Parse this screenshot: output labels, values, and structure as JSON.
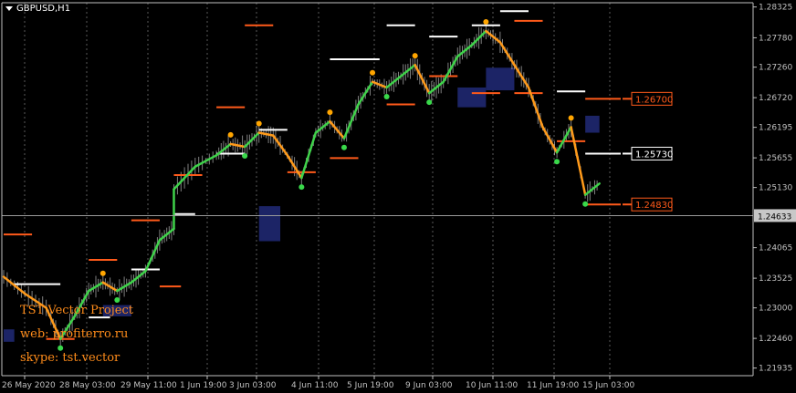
{
  "symbol_title": "GBPUSD,H1",
  "watermark": {
    "line1": "TST Vector Project",
    "line2": "web: profiterro.ru",
    "line3": "skype: tst.vector"
  },
  "colors": {
    "background": "#000000",
    "axis": "#c0c0c0",
    "candle": "#e8e8e8",
    "bull_line": "#3fd24a",
    "bear_line": "#ff9a1a",
    "resistance": "#ffffff",
    "support": "#ff5a1a",
    "zone": "#1c2466",
    "dot_green": "#39d84a",
    "dot_orange": "#ffa500"
  },
  "chart_data": {
    "type": "line",
    "y_ticks": [
      "1.28325",
      "1.27780",
      "1.27260",
      "1.26720",
      "1.26195",
      "1.25655",
      "1.25130",
      "1.24633",
      "1.24065",
      "1.23525",
      "1.23000",
      "1.22460",
      "1.21935"
    ],
    "ylim": [
      1.218,
      1.284
    ],
    "x_ticks": [
      "26 May 2020",
      "28 May 03:00",
      "29 May 11:00",
      "1 Jun 19:00",
      "3 Jun 03:00",
      "4 Jun 11:00",
      "5 Jun 19:00",
      "9 Jun 03:00",
      "10 Jun 11:00",
      "11 Jun 19:00",
      "15 Jun 03:00"
    ],
    "current_price": "1.24633",
    "price_labels": [
      {
        "text": "1.26700",
        "value": 1.267,
        "kind": "support"
      },
      {
        "text": "1.25730",
        "value": 1.2573,
        "kind": "resistance"
      },
      {
        "text": "1.24830",
        "value": 1.2483,
        "kind": "support"
      }
    ],
    "series": [
      {
        "name": "",
        "role": "close",
        "x": [
          "26 May 00",
          "26 May 12",
          "27 May 00",
          "27 May 08",
          "27 May 16",
          "28 May 00",
          "28 May 08",
          "28 May 16",
          "29 May 00",
          "29 May 08",
          "29 May 16",
          "30 May 00",
          "1 Jun 00",
          "1 Jun 12",
          "2 Jun 00",
          "2 Jun 08",
          "2 Jun 16",
          "3 Jun 00",
          "3 Jun 08",
          "3 Jun 16",
          "4 Jun 00",
          "4 Jun 08",
          "4 Jun 16",
          "5 Jun 00",
          "5 Jun 08",
          "5 Jun 16",
          "8 Jun 00",
          "8 Jun 08",
          "8 Jun 16",
          "9 Jun 00",
          "9 Jun 08",
          "9 Jun 16",
          "10 Jun 00",
          "10 Jun 08",
          "10 Jun 16",
          "11 Jun 00",
          "11 Jun 08",
          "11 Jun 16",
          "12 Jun 00",
          "12 Jun 08",
          "12 Jun 16",
          "15 Jun 00"
        ],
        "y": [
          1.2355,
          1.2325,
          1.23,
          1.2245,
          1.2285,
          1.233,
          1.2345,
          1.233,
          1.2345,
          1.2365,
          1.242,
          1.244,
          1.251,
          1.255,
          1.257,
          1.259,
          1.2585,
          1.261,
          1.2605,
          1.257,
          1.253,
          1.261,
          1.263,
          1.26,
          1.266,
          1.27,
          1.269,
          1.271,
          1.273,
          1.268,
          1.27,
          1.2745,
          1.2765,
          1.279,
          1.277,
          1.273,
          1.269,
          1.262,
          1.2575,
          1.262,
          1.25,
          1.252
        ]
      }
    ],
    "resistance_levels": [
      {
        "x_start": "26 May 06",
        "x_end": "27 May 08",
        "value": 1.2342
      },
      {
        "x_start": "28 May 00",
        "x_end": "28 May 12",
        "value": 1.2283
      },
      {
        "x_start": "29 May 00",
        "x_end": "29 May 16",
        "value": 1.2368
      },
      {
        "x_start": "1 Jun 00",
        "x_end": "1 Jun 12",
        "value": 1.2466
      },
      {
        "x_start": "2 Jun 00",
        "x_end": "2 Jun 16",
        "value": 1.2573
      },
      {
        "x_start": "3 Jun 00",
        "x_end": "3 Jun 16",
        "value": 1.2615
      },
      {
        "x_start": "4 Jun 16",
        "x_end": "5 Jun 08",
        "value": 1.274
      },
      {
        "x_start": "5 Jun 08",
        "x_end": "5 Jun 20",
        "value": 1.274
      },
      {
        "x_start": "8 Jun 00",
        "x_end": "8 Jun 16",
        "value": 1.28
      },
      {
        "x_start": "9 Jun 00",
        "x_end": "9 Jun 16",
        "value": 1.278
      },
      {
        "x_start": "10 Jun 00",
        "x_end": "10 Jun 16",
        "value": 1.28
      },
      {
        "x_start": "10 Jun 16",
        "x_end": "11 Jun 08",
        "value": 1.2825
      },
      {
        "x_start": "12 Jun 00",
        "x_end": "12 Jun 16",
        "value": 1.2683
      },
      {
        "x_start": "12 Jun 16",
        "x_end": "15 Jun 12",
        "value": 1.2573
      }
    ],
    "support_levels": [
      {
        "x_start": "26 May 00",
        "x_end": "26 May 16",
        "value": 1.243
      },
      {
        "x_start": "27 May 00",
        "x_end": "27 May 16",
        "value": 1.2245
      },
      {
        "x_start": "28 May 00",
        "x_end": "28 May 16",
        "value": 1.2385
      },
      {
        "x_start": "29 May 00",
        "x_end": "29 May 16",
        "value": 1.2455
      },
      {
        "x_start": "29 May 16",
        "x_end": "1 Jun 04",
        "value": 1.2338
      },
      {
        "x_start": "1 Jun 00",
        "x_end": "1 Jun 16",
        "value": 1.2535
      },
      {
        "x_start": "2 Jun 00",
        "x_end": "2 Jun 16",
        "value": 1.2655
      },
      {
        "x_start": "2 Jun 16",
        "x_end": "3 Jun 08",
        "value": 1.28
      },
      {
        "x_start": "3 Jun 16",
        "x_end": "4 Jun 08",
        "value": 1.254
      },
      {
        "x_start": "4 Jun 16",
        "x_end": "5 Jun 08",
        "value": 1.2565
      },
      {
        "x_start": "8 Jun 00",
        "x_end": "8 Jun 16",
        "value": 1.266
      },
      {
        "x_start": "9 Jun 00",
        "x_end": "9 Jun 16",
        "value": 1.271
      },
      {
        "x_start": "10 Jun 00",
        "x_end": "10 Jun 16",
        "value": 1.268
      },
      {
        "x_start": "11 Jun 00",
        "x_end": "11 Jun 16",
        "value": 1.268
      },
      {
        "x_start": "11 Jun 00",
        "x_end": "11 Jun 16",
        "value": 1.2808
      },
      {
        "x_start": "12 Jun 00",
        "x_end": "12 Jun 16",
        "value": 1.2595
      },
      {
        "x_start": "12 Jun 16",
        "x_end": "15 Jun 12",
        "value": 1.267
      },
      {
        "x_start": "12 Jun 16",
        "x_end": "15 Jun 12",
        "value": 1.2483
      }
    ],
    "zones": [
      {
        "x_start": "26 May 00",
        "x_end": "26 May 06",
        "low": 1.224,
        "high": 1.2262
      },
      {
        "x_start": "28 May 08",
        "x_end": "29 May 00",
        "low": 1.2285,
        "high": 1.2305
      },
      {
        "x_start": "3 Jun 00",
        "x_end": "3 Jun 12",
        "low": 1.2418,
        "high": 1.248
      },
      {
        "x_start": "9 Jun 16",
        "x_end": "10 Jun 08",
        "low": 1.2655,
        "high": 1.269
      },
      {
        "x_start": "10 Jun 08",
        "x_end": "11 Jun 00",
        "low": 1.2685,
        "high": 1.2725
      },
      {
        "x_start": "12 Jun 16",
        "x_end": "15 Jun 00",
        "low": 1.261,
        "high": 1.264
      }
    ],
    "grid": true,
    "legend": "none"
  }
}
